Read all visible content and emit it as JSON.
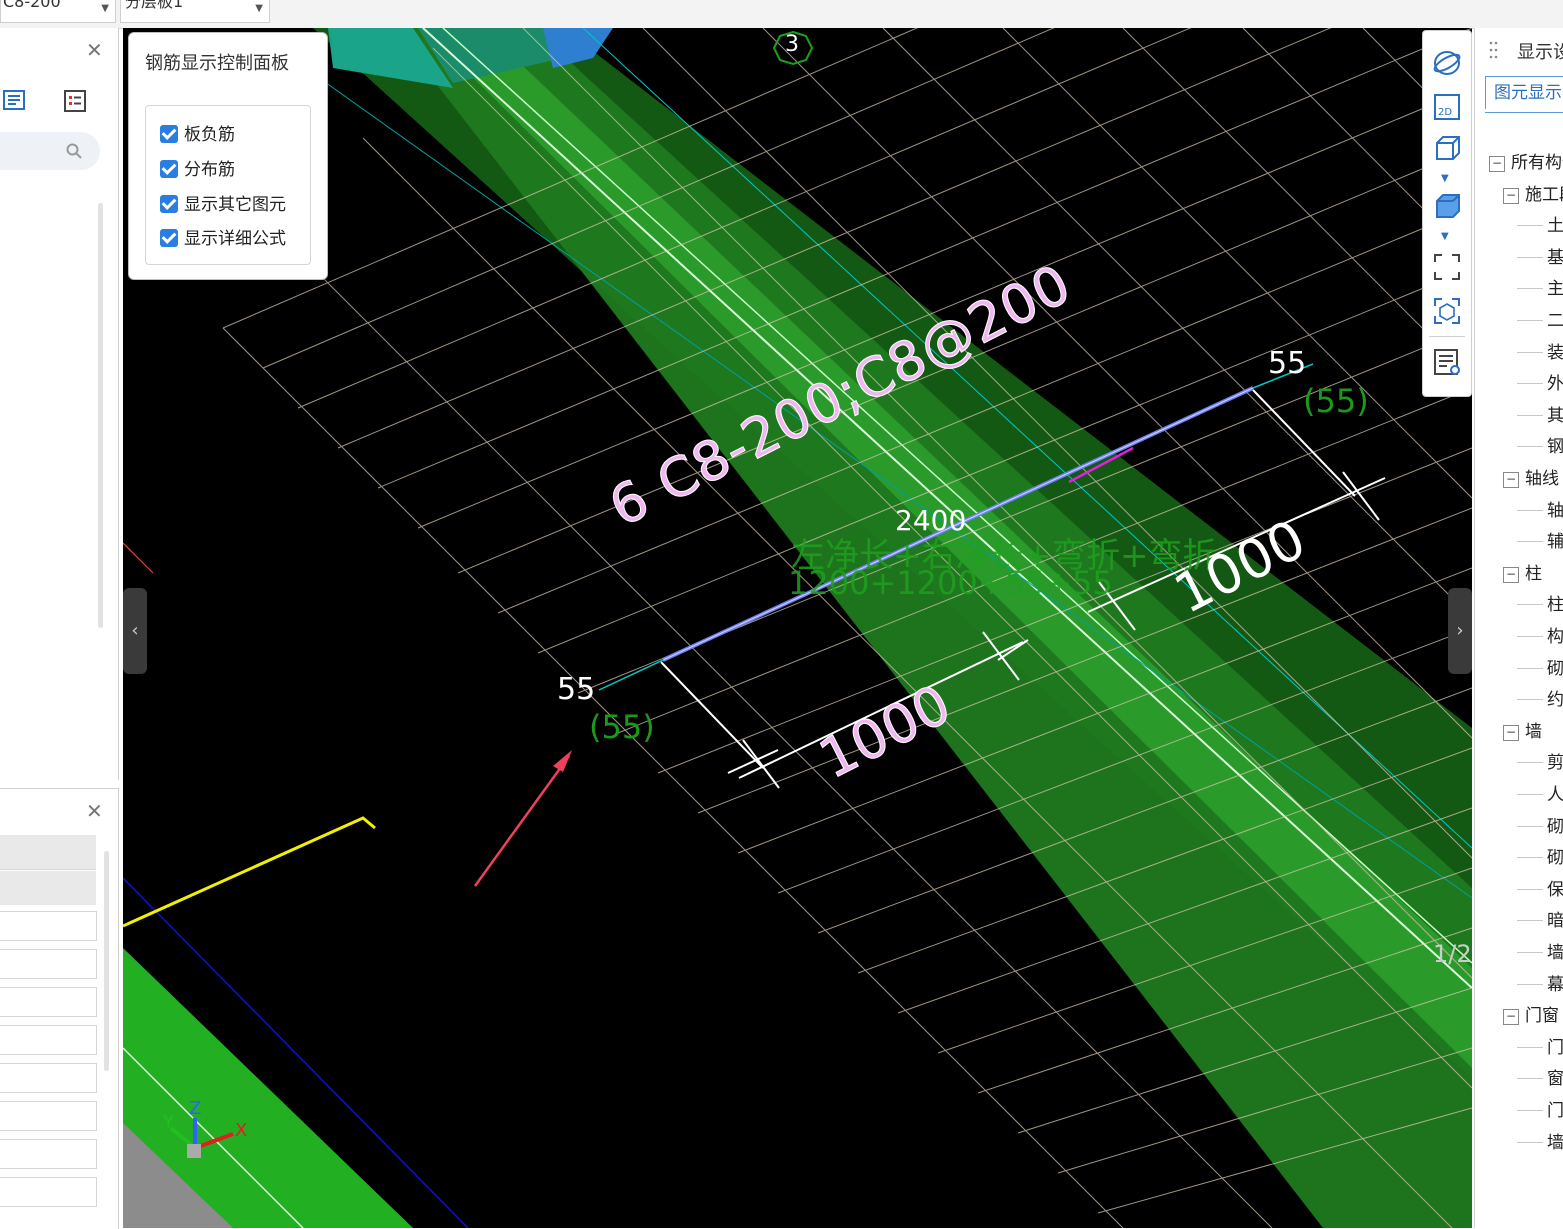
{
  "toolbar": {
    "combo1_value": "C8-200",
    "combo2_value": "分层板1"
  },
  "control_panel": {
    "title": "钢筋显示控制面板",
    "options": [
      {
        "label": "板负筋",
        "checked": true
      },
      {
        "label": "分布筋",
        "checked": true
      },
      {
        "label": "显示其它图元",
        "checked": true
      },
      {
        "label": "显示详细公式",
        "checked": true
      }
    ]
  },
  "viewport": {
    "axis_label": "3",
    "rebar_label": "6 C8-200;C8@200",
    "total_length": "2400",
    "formula_text": "左净长+右净长+弯折+弯折",
    "formula_values": "1200+1200+55+55",
    "dim_left": "1000",
    "dim_right": "1000",
    "hook_left": "55",
    "hook_left_sub": "(55)",
    "hook_right": "55",
    "hook_right_sub": "(55)",
    "page_indicator": "1/2",
    "axis_x": "X",
    "axis_y": "Y",
    "axis_z": "Z"
  },
  "right_panel": {
    "header": "显示设置",
    "tab": "图元显示",
    "tree": [
      {
        "label": "所有构件",
        "level": 0,
        "expand": true
      },
      {
        "label": "施工段",
        "level": 1,
        "expand": true
      },
      {
        "label": "土",
        "level": 2
      },
      {
        "label": "基",
        "level": 2
      },
      {
        "label": "主",
        "level": 2
      },
      {
        "label": "二",
        "level": 2
      },
      {
        "label": "装",
        "level": 2
      },
      {
        "label": "外",
        "level": 2
      },
      {
        "label": "其",
        "level": 2
      },
      {
        "label": "钢",
        "level": 2
      },
      {
        "label": "轴线",
        "level": 1,
        "expand": true
      },
      {
        "label": "轴",
        "level": 2
      },
      {
        "label": "辅",
        "level": 2
      },
      {
        "label": "柱",
        "level": 1,
        "expand": true
      },
      {
        "label": "柱",
        "level": 2
      },
      {
        "label": "构",
        "level": 2
      },
      {
        "label": "砌",
        "level": 2
      },
      {
        "label": "约",
        "level": 2
      },
      {
        "label": "墙",
        "level": 1,
        "expand": true
      },
      {
        "label": "剪",
        "level": 2
      },
      {
        "label": "人",
        "level": 2
      },
      {
        "label": "砌",
        "level": 2
      },
      {
        "label": "砌",
        "level": 2
      },
      {
        "label": "保",
        "level": 2
      },
      {
        "label": "暗",
        "level": 2
      },
      {
        "label": "墙",
        "level": 2
      },
      {
        "label": "幕",
        "level": 2
      },
      {
        "label": "门窗",
        "level": 1,
        "expand": true
      },
      {
        "label": "门",
        "level": 2
      },
      {
        "label": "窗",
        "level": 2
      },
      {
        "label": "门",
        "level": 2
      },
      {
        "label": "墙",
        "level": 2
      }
    ]
  },
  "colors": {
    "slab_green": "#1f7a1f",
    "label_pink": "#f0b8f0",
    "formula_green": "#1fa01f",
    "accent_blue": "#2a7de1"
  }
}
